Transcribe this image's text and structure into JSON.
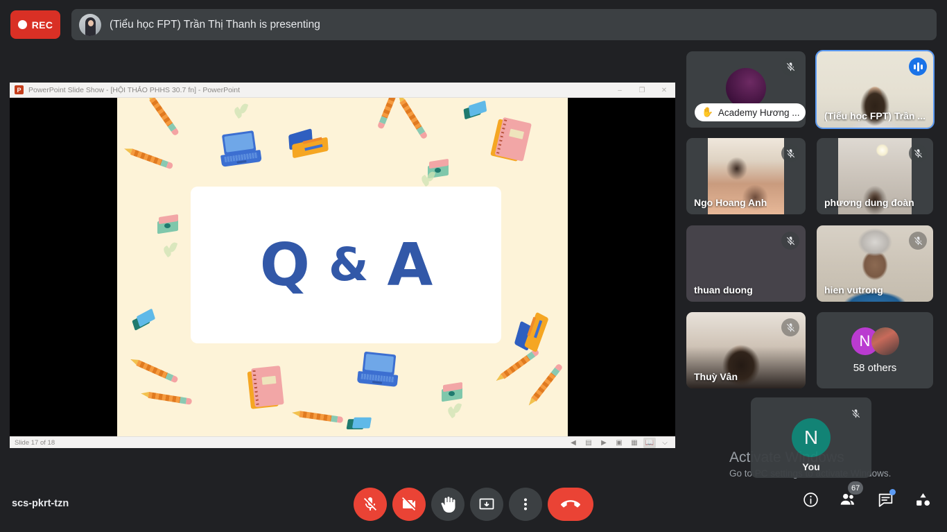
{
  "meeting": {
    "code": "scs-pkrt-tzn",
    "recording_label": "REC",
    "presenting_text": "(Tiểu học FPT) Trần Thị Thanh is presenting"
  },
  "presentation": {
    "window_title": "PowerPoint Slide Show - [HỘI THẢO PHHS 30.7 fn] - PowerPoint",
    "app_logo_letter": "P",
    "status_text": "Slide 17 of 18",
    "slide": {
      "letters": [
        "Q",
        "&",
        "A"
      ],
      "background_color": "#fdf3d8",
      "text_color": "#3258a8"
    },
    "window_controls": {
      "minimize": "–",
      "restore": "❐",
      "close": "✕"
    },
    "status_icons": [
      "prev-slide-icon",
      "notes-icon",
      "play-icon",
      "normal-view-icon",
      "slide-sorter-icon",
      "reading-view-icon",
      "slideshow-icon"
    ]
  },
  "participants": [
    {
      "name": "Academy Hương ...",
      "muted": true,
      "hand_raised": true,
      "has_video": false,
      "avatar_type": "photo-purple",
      "active": false
    },
    {
      "name": "(Tiểu học FPT) Trần ...",
      "muted": false,
      "hand_raised": false,
      "has_video": true,
      "speaking": true,
      "active": true
    },
    {
      "name": "Ngo Hoang Anh",
      "muted": true,
      "hand_raised": false,
      "has_video": true,
      "active": false
    },
    {
      "name": "phương dung đoàn",
      "muted": true,
      "hand_raised": false,
      "has_video": true,
      "active": false
    },
    {
      "name": "thuan duong",
      "muted": true,
      "hand_raised": false,
      "has_video": false,
      "active": false
    },
    {
      "name": "hien vutrong",
      "muted": true,
      "hand_raised": false,
      "has_video": true,
      "active": false
    },
    {
      "name": "Thuỳ Vân",
      "muted": true,
      "hand_raised": false,
      "has_video": true,
      "active": false
    }
  ],
  "others_tile": {
    "label": "58 others",
    "avatar_initial": "N",
    "avatar_color": "#ba3bd0"
  },
  "self_tile": {
    "name": "You",
    "initial": "N",
    "avatar_color": "#12897a",
    "muted": true
  },
  "watermark": {
    "line1": "Activate Windows",
    "line2": "Go to PC settings to activate Windows."
  },
  "controls": [
    {
      "name": "microphone-button",
      "icon": "mic-off-icon",
      "state": "muted",
      "color": "#ea4335"
    },
    {
      "name": "camera-button",
      "icon": "camera-off-icon",
      "state": "off",
      "color": "#ea4335"
    },
    {
      "name": "raise-hand-button",
      "icon": "hand-icon",
      "state": "default",
      "color": "#3c4043"
    },
    {
      "name": "present-button",
      "icon": "present-screen-icon",
      "state": "default",
      "color": "#3c4043"
    },
    {
      "name": "more-options-button",
      "icon": "more-vertical-icon",
      "state": "default",
      "color": "#3c4043"
    },
    {
      "name": "leave-call-button",
      "icon": "hangup-icon",
      "state": "default",
      "color": "#ea4335"
    }
  ],
  "right_icons": [
    {
      "name": "meeting-details-button",
      "icon": "info-icon",
      "badge": null,
      "dot": false
    },
    {
      "name": "participants-button",
      "icon": "people-icon",
      "badge": "67",
      "dot": false
    },
    {
      "name": "chat-button",
      "icon": "chat-icon",
      "badge": null,
      "dot": true
    },
    {
      "name": "activities-button",
      "icon": "activities-icon",
      "badge": null,
      "dot": false
    }
  ],
  "colors": {
    "app_bg": "#202124",
    "tile_bg": "#3c4043",
    "accent_blue": "#5b9bf5",
    "danger_red": "#ea4335",
    "rec_red": "#d93025"
  }
}
